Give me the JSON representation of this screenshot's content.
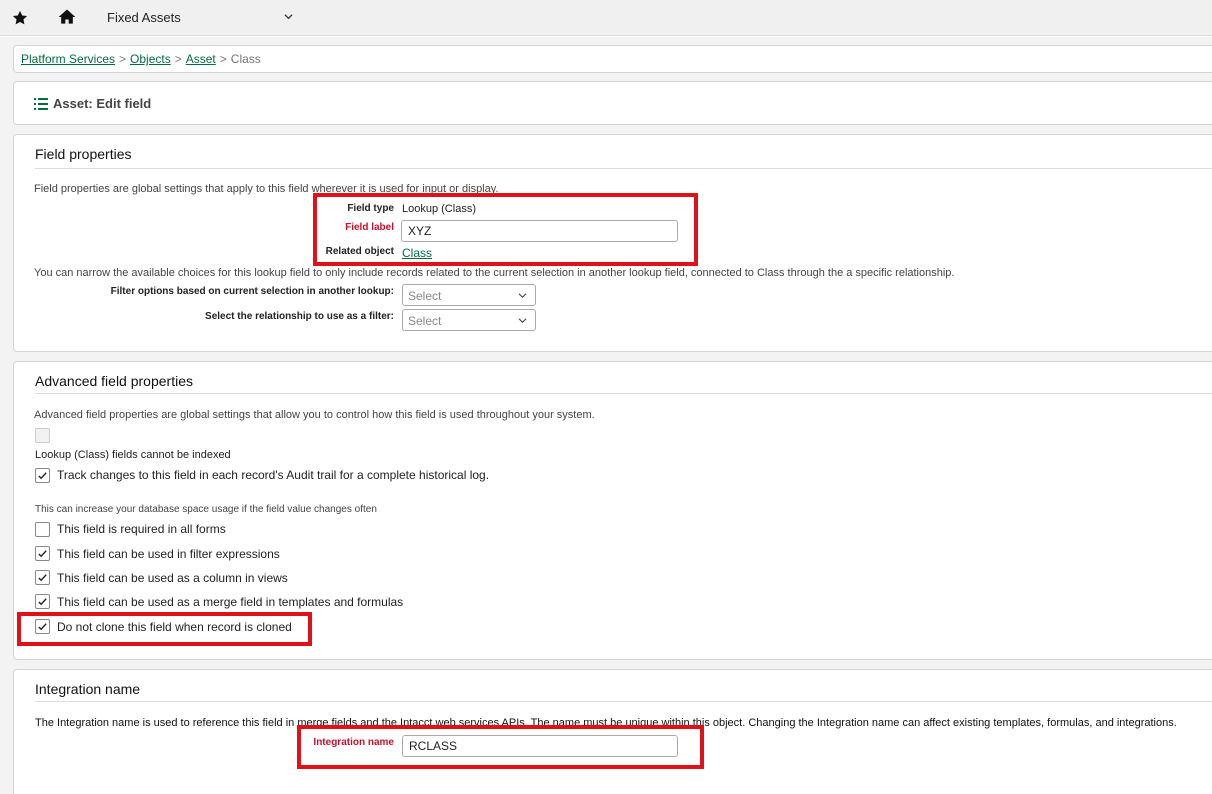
{
  "topbar": {
    "app_title": "Fixed Assets"
  },
  "breadcrumb": {
    "items": [
      "Platform Services",
      "Objects",
      "Asset"
    ],
    "current": "Class",
    "separator": ">"
  },
  "page": {
    "title": "Asset: Edit field"
  },
  "field_properties": {
    "title": "Field properties",
    "description": "Field properties are global settings that apply to this field wherever it is used for input or display.",
    "field_type_label": "Field type",
    "field_type_value": "Lookup (Class)",
    "field_label_label": "Field label",
    "field_label_value": "XYZ",
    "related_object_label": "Related object",
    "related_object_value": "Class",
    "narrow_text": "You can narrow the available choices for this lookup field to only include records related to the current selection in another lookup field, connected to Class through the a specific relationship.",
    "filter_label": "Filter options based on current selection in another lookup:",
    "filter_placeholder": "Select",
    "relationship_label": "Select the relationship to use as a filter:",
    "relationship_placeholder": "Select"
  },
  "advanced": {
    "title": "Advanced field properties",
    "description": "Advanced field properties are global settings that allow you to control how this field is used throughout your system.",
    "index_note": "Lookup (Class) fields cannot be indexed",
    "track_label": "Track changes to this field in each record's Audit trail for a complete historical log.",
    "db_note": "This can increase your database space usage if the field value changes often",
    "options": [
      {
        "label": "This field is required in all forms",
        "checked": false
      },
      {
        "label": "This field can be used in filter expressions",
        "checked": true
      },
      {
        "label": "This field can be used as a column in views",
        "checked": true
      },
      {
        "label": "This field can be used as a merge field in templates and formulas",
        "checked": true
      },
      {
        "label": "Do not clone this field when record is cloned",
        "checked": true
      }
    ]
  },
  "integration": {
    "title": "Integration name",
    "description": "The Integration name is used to reference this field in merge fields and the Intacct web services APIs. The name must be unique within this object. Changing the Integration name can affect existing templates, formulas, and integrations.",
    "name_label": "Integration name",
    "name_value": "RCLASS"
  },
  "colors": {
    "link": "#006d3e",
    "required": "#c8102e",
    "highlight": "#e1111a"
  },
  "icons": [
    "star-icon",
    "home-icon",
    "chevron-down-icon",
    "list-icon",
    "checkmark-icon"
  ]
}
